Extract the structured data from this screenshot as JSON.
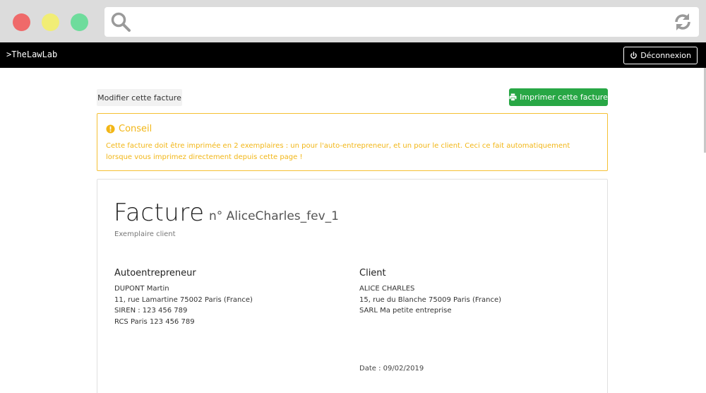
{
  "browser": {
    "icons": {
      "search": "search-icon",
      "reload": "reload-icon"
    },
    "colors": {
      "close": "#ef6a6a",
      "minimize": "#f1ed75",
      "maximize": "#6edc9c"
    }
  },
  "appbar": {
    "brand": ">TheLawLab",
    "logout_label": "Déconnexion"
  },
  "actions": {
    "edit_label": "Modifier cette facture",
    "print_label": "Imprimer cette facture"
  },
  "notice": {
    "title": "Conseil",
    "text": "Cette facture doit être imprimée en 2 exemplaires : un pour l'auto-entrepreneur, et un pour le client. Ceci ce fait automatiquement lorsque vous imprimez directement depuis cette page !"
  },
  "invoice": {
    "title": "Facture",
    "number": "n° AliceCharles_fev_1",
    "copy_label": "Exemplaire client",
    "seller": {
      "heading": "Autoentrepreneur",
      "lines": [
        "DUPONT Martin",
        "11, rue Lamartine 75002 Paris (France)",
        "SIREN : 123 456 789",
        "RCS Paris 123 456 789"
      ]
    },
    "client": {
      "heading": "Client",
      "lines": [
        "ALICE CHARLES",
        "15, rue du Blanche 75009 Paris (France)",
        "SARL Ma petite entreprise"
      ]
    },
    "date": "Date : 09/02/2019"
  },
  "colors": {
    "print_button": "#28a745",
    "notice_accent": "#f2b616",
    "appbar_bg": "#000000"
  }
}
